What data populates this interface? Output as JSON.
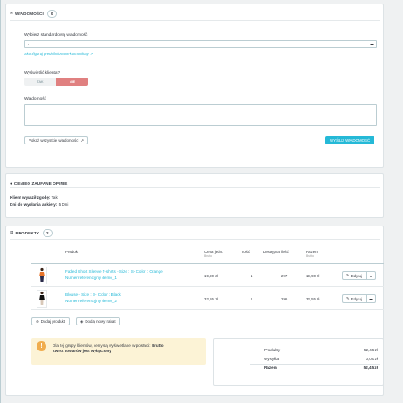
{
  "messages": {
    "title": "WIADOMOŚCI",
    "count": "0",
    "select_label": "Wybierz standardową wiadomość",
    "select_value": "-",
    "configure_link": "Skonfiguruj predefiniowane komunikaty",
    "show_client_label": "Wyświetlić klienta?",
    "toggle_yes": "TAK",
    "toggle_no": "NIE",
    "message_label": "Wiadomość",
    "message_value": "",
    "show_all_button": "Pokaż wszystkie wiadomości",
    "send_button": "WYŚLIJ WIADOMOŚĆ"
  },
  "reviews": {
    "title": "CENIEO ZAUFANE OPINIE",
    "consent_label": "Klient wyraził zgodę:",
    "consent_value": "Tak",
    "days_label": "Dni do wysłania ankiety:",
    "days_value": "5 Dni"
  },
  "products": {
    "title": "PRODUKTY",
    "count": "2",
    "columns": {
      "product": "Produkt",
      "unit_price": "Cena jedn.",
      "unit_price_sub": "Brutto",
      "qty": "Ilość",
      "available": "Dostępna ilość",
      "total": "Razem",
      "total_sub": "Brutto"
    },
    "rows": [
      {
        "name": "Faded Short Sleeve T-shirts - Size : S- Color : Orange",
        "ref": "Numer referencyjny demo_1",
        "price": "19,90 zł",
        "qty": "1",
        "available": "297",
        "total": "19,90 zł",
        "edit": "Edytuj"
      },
      {
        "name": "Blouse - Size : S- Color : Black",
        "ref": "Numer referencyjny demo_2",
        "price": "32,55 zł",
        "qty": "1",
        "available": "296",
        "total": "32,55 zł",
        "edit": "Edytuj"
      }
    ],
    "add_product_button": "Dodaj produkt",
    "add_discount_button": "Dodaj nowy rabat",
    "alert_line1": "Dla tej grupy klientów, ceny są wyświetlane w postaci:",
    "alert_bold1": "Brutto",
    "alert_line2": "Zwrot towarów jest wyłączony",
    "totals": [
      {
        "label": "Produkty",
        "value": "52,45 zł"
      },
      {
        "label": "Wysyłka",
        "value": "0,00 zł"
      },
      {
        "label": "Razem",
        "value": "52,45 zł"
      }
    ]
  },
  "colors": {
    "accent": "#25b9d7",
    "danger": "#e08080",
    "warning_bg": "#fcf3d6",
    "warning_icon": "#f0ad4e"
  }
}
